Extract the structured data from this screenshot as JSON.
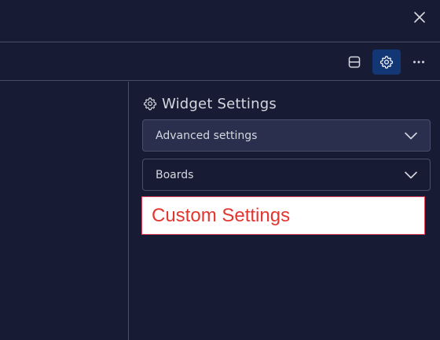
{
  "header": {
    "close_icon": "close-icon"
  },
  "toolbar": {
    "buttons": [
      {
        "icon": "layout-icon"
      },
      {
        "icon": "gear-icon",
        "active": true
      },
      {
        "icon": "more-horizontal-icon"
      }
    ],
    "active_color": "#133774"
  },
  "settings_panel": {
    "title": "Widget Settings",
    "title_icon": "gear-icon",
    "sections": [
      {
        "label": "Advanced settings",
        "icon": "chevron-down-icon",
        "expanded": false
      },
      {
        "label": "Boards",
        "icon": "chevron-down-icon",
        "expanded": false
      }
    ],
    "custom_box": {
      "text": "Custom Settings",
      "text_color": "#e2362f",
      "border_color": "#e2445c"
    }
  },
  "theme": {
    "background": "#181b34",
    "divider": "#4b4e69",
    "section_bg": "#292f4c",
    "text": "#d5d8df"
  }
}
